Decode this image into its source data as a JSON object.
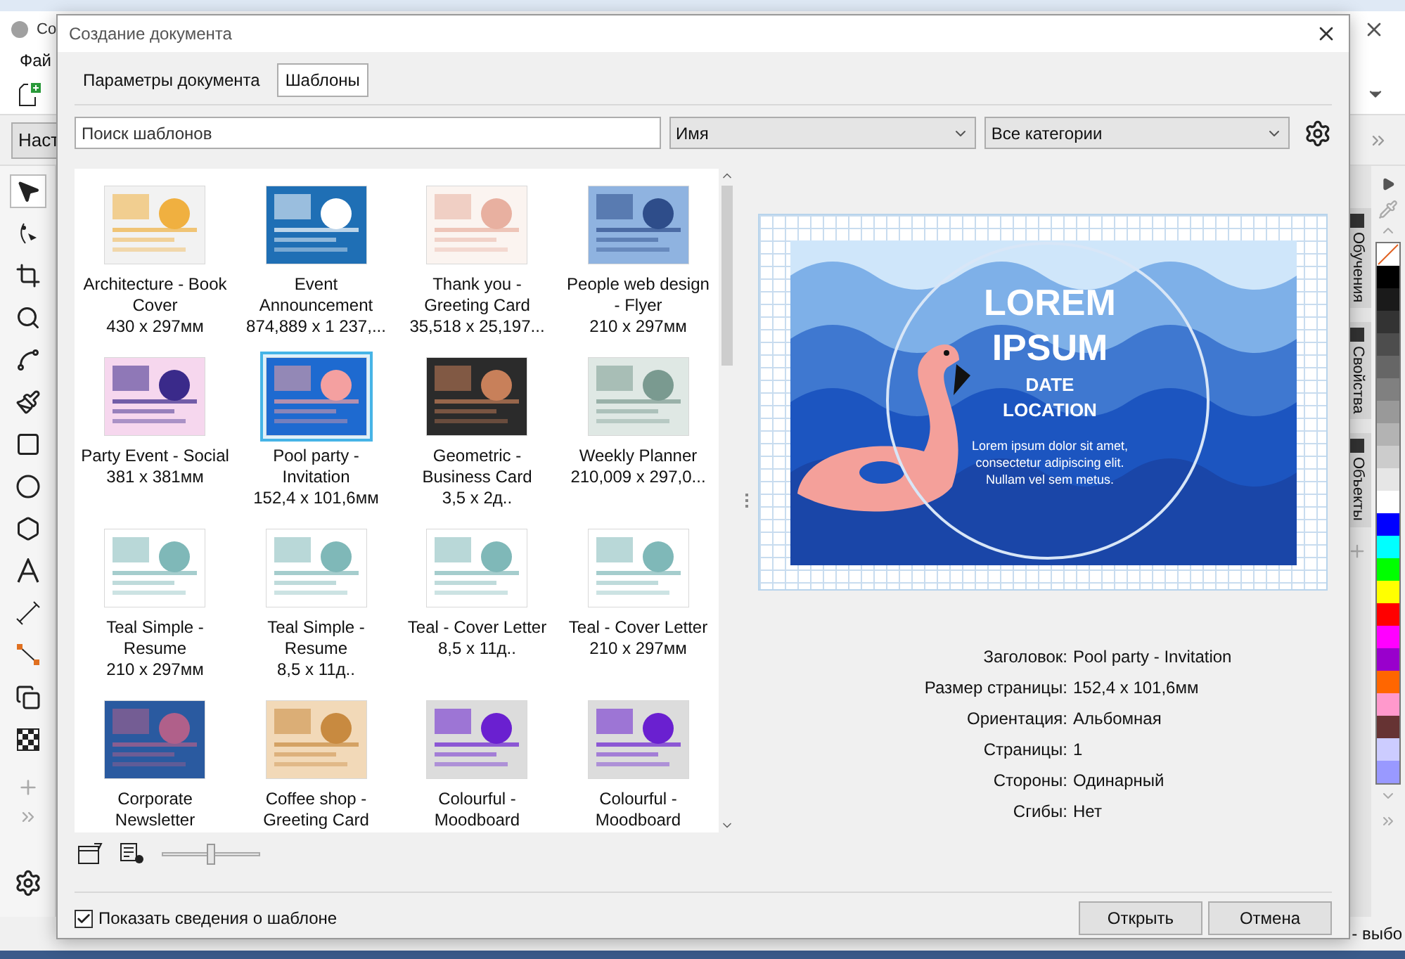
{
  "app": {
    "title": "Co",
    "menu": [
      "Фай"
    ],
    "property_button": "Наст",
    "status_text": "- выбо"
  },
  "toolbox": [
    {
      "kind": "pick",
      "selected": true
    },
    {
      "kind": "shape",
      "selected": false
    },
    {
      "kind": "crop",
      "selected": false
    },
    {
      "kind": "zoom",
      "selected": false
    },
    {
      "kind": "freehand",
      "selected": false
    },
    {
      "kind": "brush",
      "selected": false
    },
    {
      "kind": "rectangle",
      "selected": false
    },
    {
      "kind": "ellipse",
      "selected": false
    },
    {
      "kind": "polygon",
      "selected": false
    },
    {
      "kind": "text",
      "selected": false
    },
    {
      "kind": "dimension",
      "selected": false
    },
    {
      "kind": "connector",
      "selected": false
    },
    {
      "kind": "shadow",
      "selected": false
    },
    {
      "kind": "transparency",
      "selected": false
    }
  ],
  "dockers": [
    {
      "label": "Обучения"
    },
    {
      "label": "Свойства"
    },
    {
      "label": "Объекты"
    }
  ],
  "palette": [
    {
      "kind": "none"
    },
    {
      "kind": "swatch",
      "color": "#000000"
    },
    {
      "kind": "swatch",
      "color": "#1a1a1a"
    },
    {
      "kind": "swatch",
      "color": "#333333"
    },
    {
      "kind": "swatch",
      "color": "#4d4d4d"
    },
    {
      "kind": "swatch",
      "color": "#666666"
    },
    {
      "kind": "swatch",
      "color": "#808080"
    },
    {
      "kind": "swatch",
      "color": "#999999"
    },
    {
      "kind": "swatch",
      "color": "#b3b3b3"
    },
    {
      "kind": "swatch",
      "color": "#cccccc"
    },
    {
      "kind": "swatch",
      "color": "#e6e6e6"
    },
    {
      "kind": "swatch",
      "color": "#ffffff"
    },
    {
      "kind": "swatch",
      "color": "#0000ff"
    },
    {
      "kind": "swatch",
      "color": "#00ffff"
    },
    {
      "kind": "swatch",
      "color": "#00ff00"
    },
    {
      "kind": "swatch",
      "color": "#ffff00"
    },
    {
      "kind": "swatch",
      "color": "#ff0000"
    },
    {
      "kind": "swatch",
      "color": "#ff00ff"
    },
    {
      "kind": "swatch",
      "color": "#9900cc"
    },
    {
      "kind": "swatch",
      "color": "#ff6600"
    },
    {
      "kind": "swatch",
      "color": "#ff99cc"
    },
    {
      "kind": "swatch",
      "color": "#663333"
    },
    {
      "kind": "swatch",
      "color": "#ccccff"
    },
    {
      "kind": "swatch",
      "color": "#9999ff"
    }
  ],
  "dialog": {
    "title": "Создание документа",
    "tabs": [
      {
        "label": "Параметры документа",
        "selected": false
      },
      {
        "label": "Шаблоны",
        "selected": true
      }
    ],
    "search": {
      "placeholder": "Поиск шаблонов"
    },
    "sort": {
      "value": "Имя"
    },
    "category": {
      "value": "Все категории"
    },
    "templates": [
      {
        "title": "Architecture - Book Cover",
        "size": "430 x 297мм",
        "selected": false
      },
      {
        "title": "Event Announcement",
        "size": "874,889 x 1 237,...",
        "selected": false
      },
      {
        "title": "Thank you - Greeting Card",
        "size": "35,518 x 25,197...",
        "selected": false
      },
      {
        "title": "People web design - Flyer",
        "size": "210 x 297мм",
        "selected": false
      },
      {
        "title": "Party Event - Social",
        "size": "381 x 381мм",
        "selected": false
      },
      {
        "title": "Pool party - Invitation",
        "size": "152,4 x 101,6мм",
        "selected": true
      },
      {
        "title": "Geometric - Business Card",
        "size": "3,5 x 2д..",
        "selected": false
      },
      {
        "title": "Weekly Planner",
        "size": "210,009 x 297,0...",
        "selected": false
      },
      {
        "title": "Teal Simple - Resume",
        "size": "210 x 297мм",
        "selected": false
      },
      {
        "title": "Teal Simple - Resume",
        "size": "8,5 x 11д..",
        "selected": false
      },
      {
        "title": "Teal - Cover Letter",
        "size": "8,5 x 11д..",
        "selected": false
      },
      {
        "title": "Teal - Cover Letter",
        "size": "210 x 297мм",
        "selected": false
      },
      {
        "title": "Corporate Newsletter",
        "selected": false
      },
      {
        "title": "Coffee shop - Greeting Card",
        "selected": false
      },
      {
        "title": "Colourful - Moodboard",
        "selected": false
      },
      {
        "title": "Colourful - Moodboard",
        "selected": false
      }
    ],
    "preview": {
      "headline": [
        "LOREM",
        "IPSUM"
      ],
      "subline": [
        "DATE",
        "LOCATION"
      ],
      "body": "Lorem ipsum dolor sit amet, consectetur adipiscing elit. Nullam vel sem metus."
    },
    "details": [
      {
        "label": "Заголовок:",
        "value": "Pool party - Invitation"
      },
      {
        "label": "Размер страницы:",
        "value": "152,4 x 101,6мм"
      },
      {
        "label": "Ориентация:",
        "value": "Альбомная"
      },
      {
        "label": "Страницы:",
        "value": "1"
      },
      {
        "label": "Стороны:",
        "value": "Одинарный"
      },
      {
        "label": "Сгибы:",
        "value": "Нет"
      }
    ],
    "thumb_size": {
      "level": 0.5
    },
    "show_info": {
      "label": "Показать сведения о шаблоне",
      "checked": true
    },
    "buttons": [
      "Открыть",
      "Отмена"
    ]
  }
}
